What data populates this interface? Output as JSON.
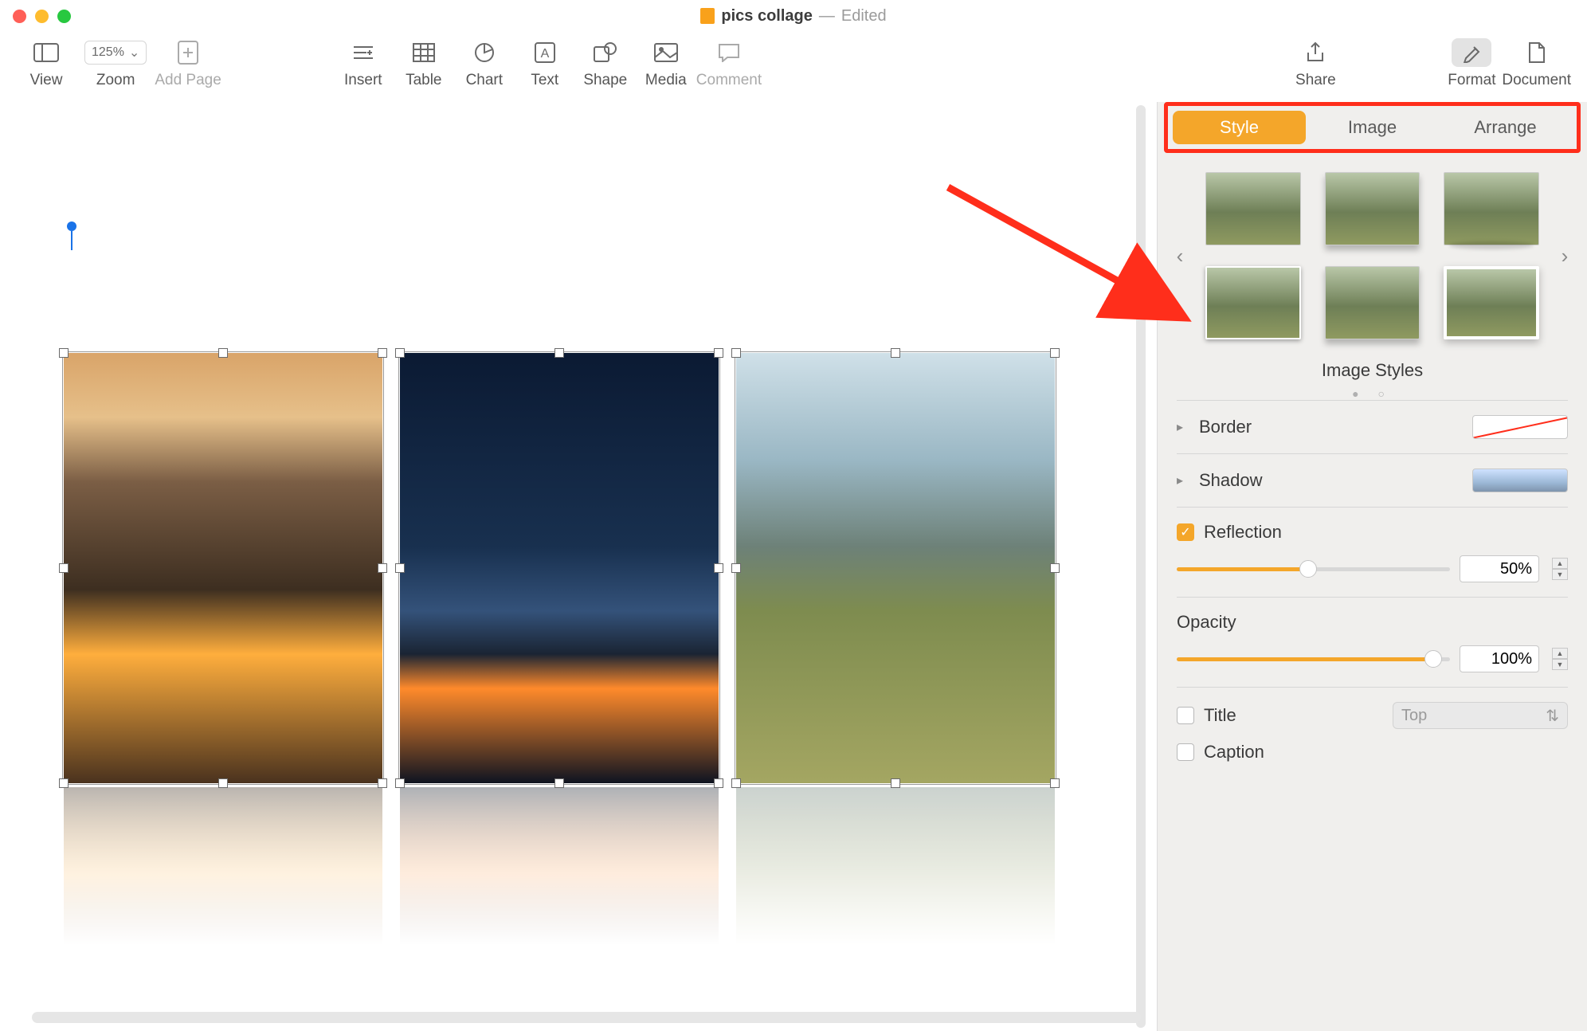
{
  "title": {
    "doc_name": "pics collage",
    "edited_label": "Edited"
  },
  "toolbar": {
    "view": "View",
    "zoom": "Zoom",
    "zoom_value": "125%",
    "add_page": "Add Page",
    "insert": "Insert",
    "table": "Table",
    "chart": "Chart",
    "text": "Text",
    "shape": "Shape",
    "media": "Media",
    "comment": "Comment",
    "share": "Share",
    "format": "Format",
    "document": "Document"
  },
  "sidebar_tabs": {
    "style": "Style",
    "image": "Image",
    "arrange": "Arrange"
  },
  "image_styles_label": "Image Styles",
  "sections": {
    "border": "Border",
    "shadow": "Shadow",
    "reflection": "Reflection",
    "reflection_value": "50%",
    "opacity": "Opacity",
    "opacity_value": "100%",
    "title": "Title",
    "title_position": "Top",
    "caption": "Caption"
  }
}
